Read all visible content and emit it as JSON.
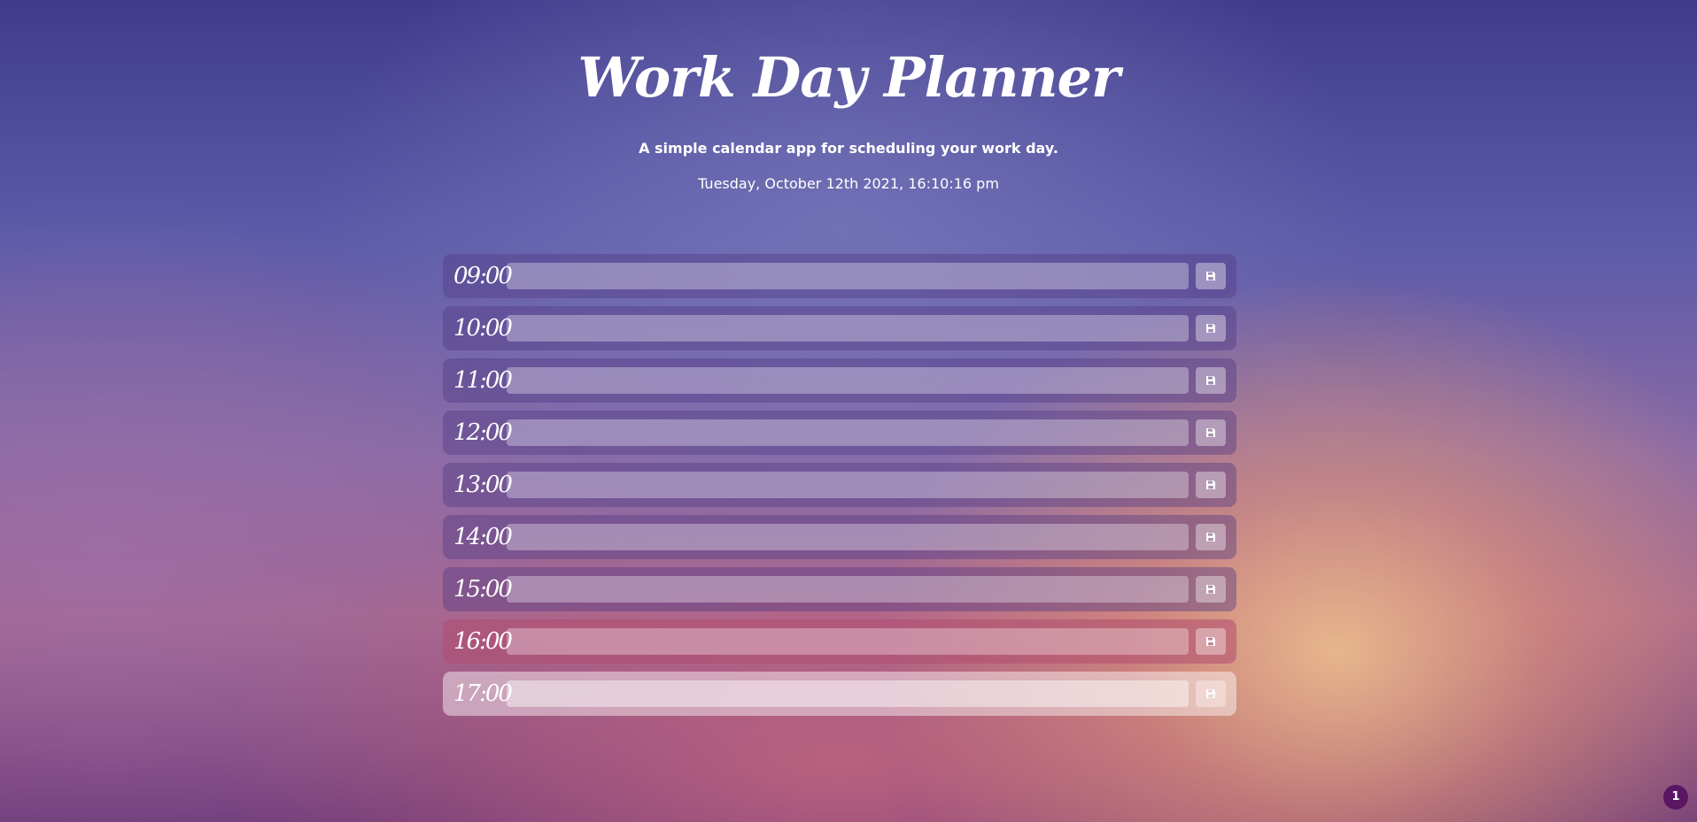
{
  "header": {
    "title": "Work Day Planner",
    "subtitle": "A simple calendar app for scheduling your work day.",
    "datetime": "Tuesday, October 12th 2021, 16:10:16 pm"
  },
  "planner": {
    "rows": [
      {
        "hour": "09:00",
        "task": "",
        "status": "past"
      },
      {
        "hour": "10:00",
        "task": "",
        "status": "past"
      },
      {
        "hour": "11:00",
        "task": "",
        "status": "past"
      },
      {
        "hour": "12:00",
        "task": "",
        "status": "past"
      },
      {
        "hour": "13:00",
        "task": "",
        "status": "past"
      },
      {
        "hour": "14:00",
        "task": "",
        "status": "past"
      },
      {
        "hour": "15:00",
        "task": "",
        "status": "past"
      },
      {
        "hour": "16:00",
        "task": "",
        "status": "present"
      },
      {
        "hour": "17:00",
        "task": "",
        "status": "future"
      }
    ],
    "save_icon": "floppy-disk-icon"
  },
  "notification_badge": {
    "count": "1"
  },
  "colors": {
    "past_row": "#6b4f93",
    "present_row": "#b44c6f",
    "future_row": "#f1dcdc",
    "badge": "#5a1563"
  }
}
